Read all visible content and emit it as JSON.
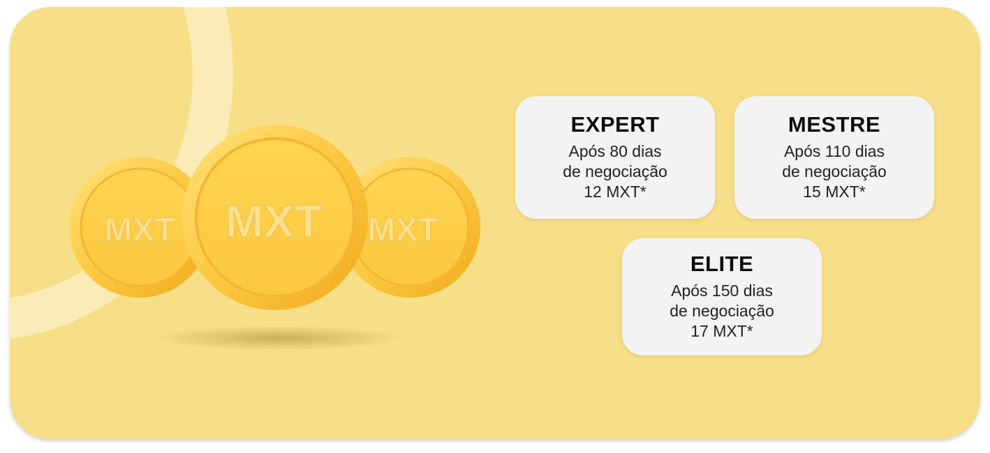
{
  "colors": {
    "background": "#f7df88",
    "card": "#f3f3f3",
    "coin": "#fbcd45"
  },
  "coins": {
    "label": "MXT",
    "icon": "mxt-coin-icon"
  },
  "tiers": [
    {
      "title": "EXPERT",
      "line1": "Após 80 dias",
      "line2": "de negociação",
      "reward": "12 MXT*"
    },
    {
      "title": "MESTRE",
      "line1": "Após 110 dias",
      "line2": "de negociação",
      "reward": "15 MXT*"
    },
    {
      "title": "ELITE",
      "line1": "Após 150 dias",
      "line2": "de negociação",
      "reward": "17 MXT*"
    }
  ]
}
